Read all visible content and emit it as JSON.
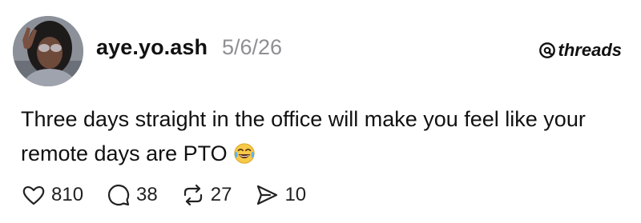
{
  "post": {
    "username": "aye.yo.ash",
    "date": "5/6/26",
    "brand": "threads",
    "text": "Three days straight in the office will make you feel like your remote days are PTO",
    "emoji": "laughing-tears-emoji"
  },
  "actions": [
    {
      "name": "like",
      "icon": "heart-icon",
      "count": "810"
    },
    {
      "name": "reply",
      "icon": "comment-icon",
      "count": "38"
    },
    {
      "name": "repost",
      "icon": "repost-icon",
      "count": "27"
    },
    {
      "name": "share",
      "icon": "send-icon",
      "count": "10"
    }
  ],
  "colors": {
    "text": "#111111",
    "muted": "#8e8e93",
    "emoji_face": "#f7c948"
  }
}
